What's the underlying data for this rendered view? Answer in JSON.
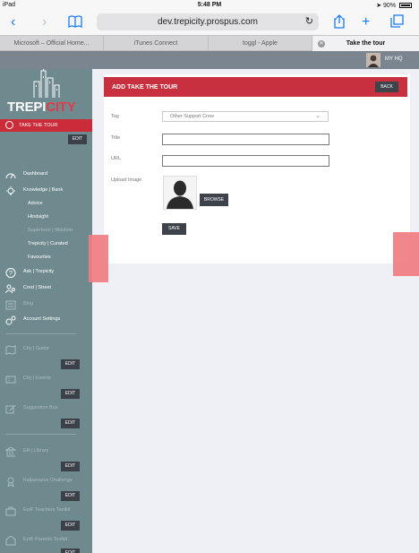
{
  "status": {
    "device": "iPad",
    "time": "5:48 PM",
    "battery": "90%"
  },
  "browser": {
    "url": "dev.trepicity.prospus.com",
    "tabs": [
      {
        "label": "Microsoft – Official Home..."
      },
      {
        "label": "iTunes Connect"
      },
      {
        "label": "toggl - Apple"
      },
      {
        "label": "Take the tour"
      }
    ]
  },
  "appbar": {
    "user_label": "MY HQ"
  },
  "sidebar": {
    "logo": {
      "part1": "TREPI",
      "part2": "CITY"
    },
    "active_item": "TAKE THE TOUR",
    "edit_label": "EDIT",
    "items": [
      {
        "label": "Dashboard",
        "icon": "dashboard-icon"
      },
      {
        "label": "Knowledge | Bank",
        "icon": "lightbulb-icon"
      },
      {
        "label": "Advice"
      },
      {
        "label": "Hindsight"
      },
      {
        "label": "Superhero | Wisdom"
      },
      {
        "label": "Trepicity | Curated"
      },
      {
        "label": "Favourites"
      },
      {
        "label": "Ask | Trepicity",
        "icon": "question-icon"
      },
      {
        "label": "Cred | Street",
        "icon": "users-icon"
      },
      {
        "label": "Blog",
        "icon": "blog-icon"
      },
      {
        "label": "Account Settings",
        "icon": "settings-icon"
      },
      {
        "label": "City | Guide",
        "icon": "map-icon"
      },
      {
        "label": "City | Events",
        "icon": "ticket-icon"
      },
      {
        "label": "Suggestion Box",
        "icon": "edit-box-icon"
      },
      {
        "label": "EA | Library",
        "icon": "library-icon"
      },
      {
        "label": "Kalpavaxux Challenge",
        "icon": "award-icon"
      },
      {
        "label": "EotF Teachers Toolkit",
        "icon": "toolkit-icon"
      },
      {
        "label": "EotF Parents Toolkit",
        "icon": "parents-icon"
      }
    ]
  },
  "form": {
    "title": "ADD TAKE THE TOUR",
    "back_label": "BACK",
    "tag_label": "Tag",
    "tag_value": "Other Support Crew",
    "title_label": "Title",
    "url_label": "URL",
    "upload_label": "Upload Image",
    "browse_label": "BROWSE",
    "save_label": "SAVE"
  },
  "colors": {
    "brand_red": "#c8303f",
    "sidebar": "#6f8a8f",
    "dark_button": "#3e434b"
  }
}
